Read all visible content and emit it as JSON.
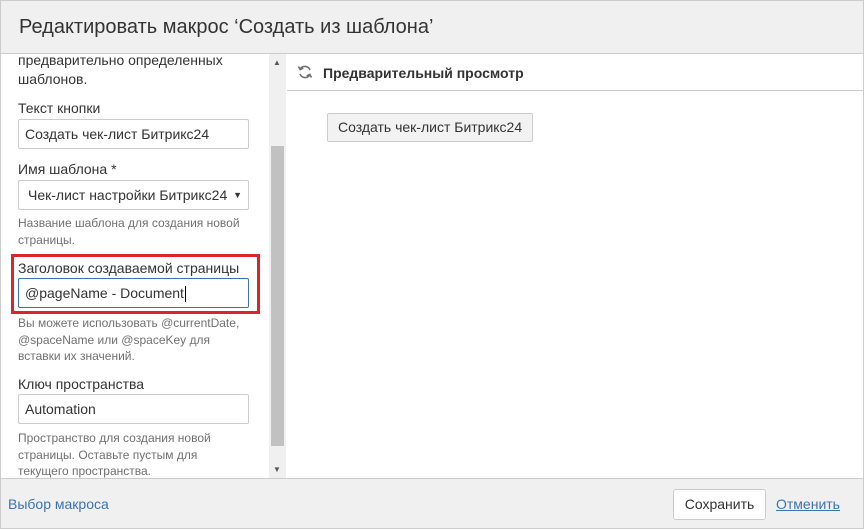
{
  "dialog": {
    "title": "Редактировать макрос ‘Создать из шаблона’"
  },
  "left_panel": {
    "intro_lines": [
      "предварительно определенных",
      "шаблонов."
    ],
    "button_text": {
      "label": "Текст кнопки",
      "value": "Создать чек-лист Битрикс24"
    },
    "template_name": {
      "label": "Имя шаблона *",
      "selected": "Чек-лист настройки Битрикс24",
      "hint_lines": [
        "Название шаблона для создания новой",
        "страницы."
      ]
    },
    "page_title": {
      "label": "Заголовок создаваемой страницы",
      "value": "@pageName - Document",
      "hint_lines": [
        "Вы можете использовать @currentDate,",
        "@spaceName или @spaceKey для",
        "вставки их значений."
      ]
    },
    "space_key": {
      "label": "Ключ пространства",
      "value": "Automation",
      "hint_lines": [
        "Пространство для создания новой",
        "страницы. Оставьте пустым для",
        "текущего пространства."
      ]
    }
  },
  "preview": {
    "title": "Предварительный просмотр",
    "button_label": "Создать чек-лист Битрикс24",
    "icon": "refresh-icon"
  },
  "footer": {
    "select_macro_link": "Выбор макроса",
    "save_label": "Сохранить",
    "cancel_label": "Отменить"
  },
  "colors": {
    "link": "#3b73af",
    "highlight": "#d9262c",
    "header_bg": "#f0f0f0"
  }
}
